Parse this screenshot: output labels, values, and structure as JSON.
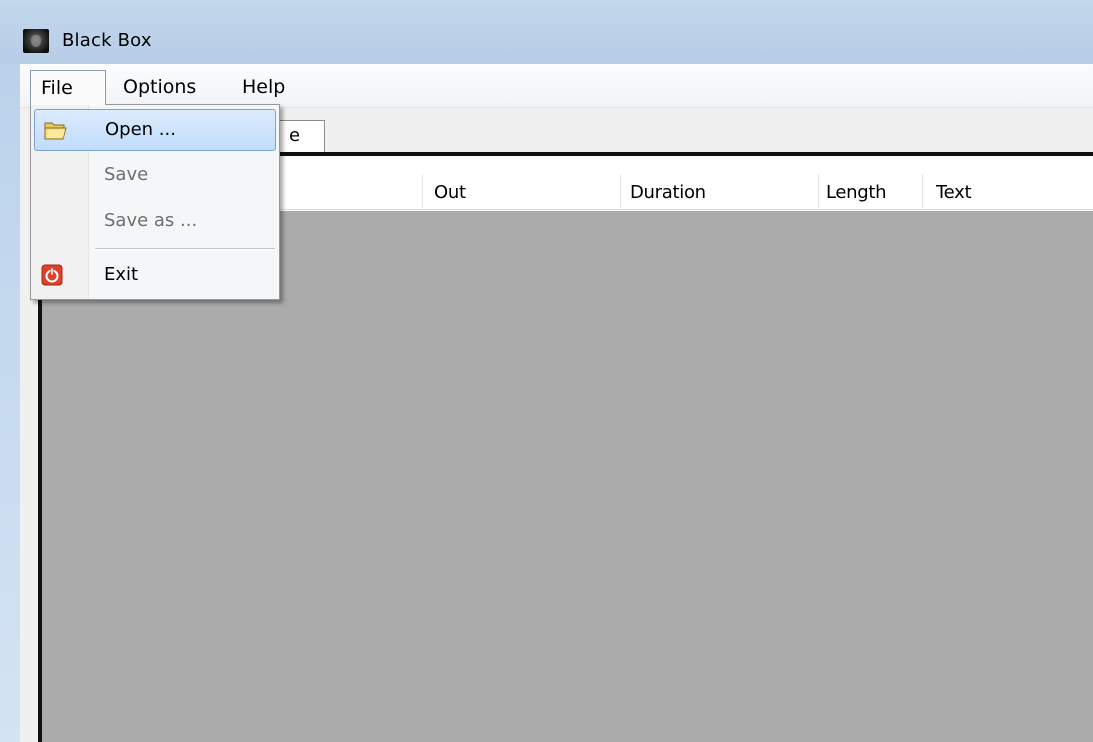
{
  "window": {
    "title": "Black Box",
    "icon": "app-icon"
  },
  "menubar": {
    "file": "File",
    "options": "Options",
    "help": "Help"
  },
  "tab": {
    "visible_label_fragment": "e"
  },
  "list": {
    "columns": [
      "Out",
      "Duration",
      "Length",
      "Text"
    ]
  },
  "file_menu": {
    "items": [
      {
        "label": "Open ...",
        "icon": "folder-open-icon",
        "state": "highlighted"
      },
      {
        "label": "Save",
        "state": "disabled"
      },
      {
        "label": "Save as ...",
        "state": "disabled"
      },
      {
        "label": "Exit",
        "icon": "power-icon",
        "state": "normal"
      }
    ]
  },
  "colors": {
    "highlight": "#c1dcfc",
    "list_background": "#ababab",
    "exit_icon": "#e0402a"
  }
}
